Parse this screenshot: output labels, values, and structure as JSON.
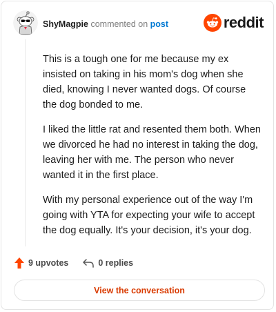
{
  "header": {
    "username": "ShyMagpie",
    "action_text": "commented on",
    "post_link": "post",
    "brand": "reddit"
  },
  "comment": {
    "paragraphs": [
      "This is a tough one for me because my ex insisted on taking in his mom's dog when she died, knowing I never wanted dogs. Of course the dog bonded to me.",
      "I liked the little rat and resented them both. When we divorced he had no interest in taking the dog, leaving her with me. The person who never wanted it in the first place.",
      "With my personal experience out of the way I'm going with YTA for expecting your wife to accept the dog equally. It's your decision, it's your dog."
    ]
  },
  "footer": {
    "upvotes": "9 upvotes",
    "replies": "0 replies"
  },
  "cta": {
    "label": "View the conversation"
  },
  "colors": {
    "brand_orange": "#ff4500",
    "link_blue": "#0079d3",
    "cta_text": "#d93a00"
  },
  "icons": {
    "avatar": "snoo-avatar-icon",
    "brand": "reddit-snoo-icon",
    "upvote": "upvote-arrow-icon",
    "reply": "reply-arrow-icon"
  }
}
